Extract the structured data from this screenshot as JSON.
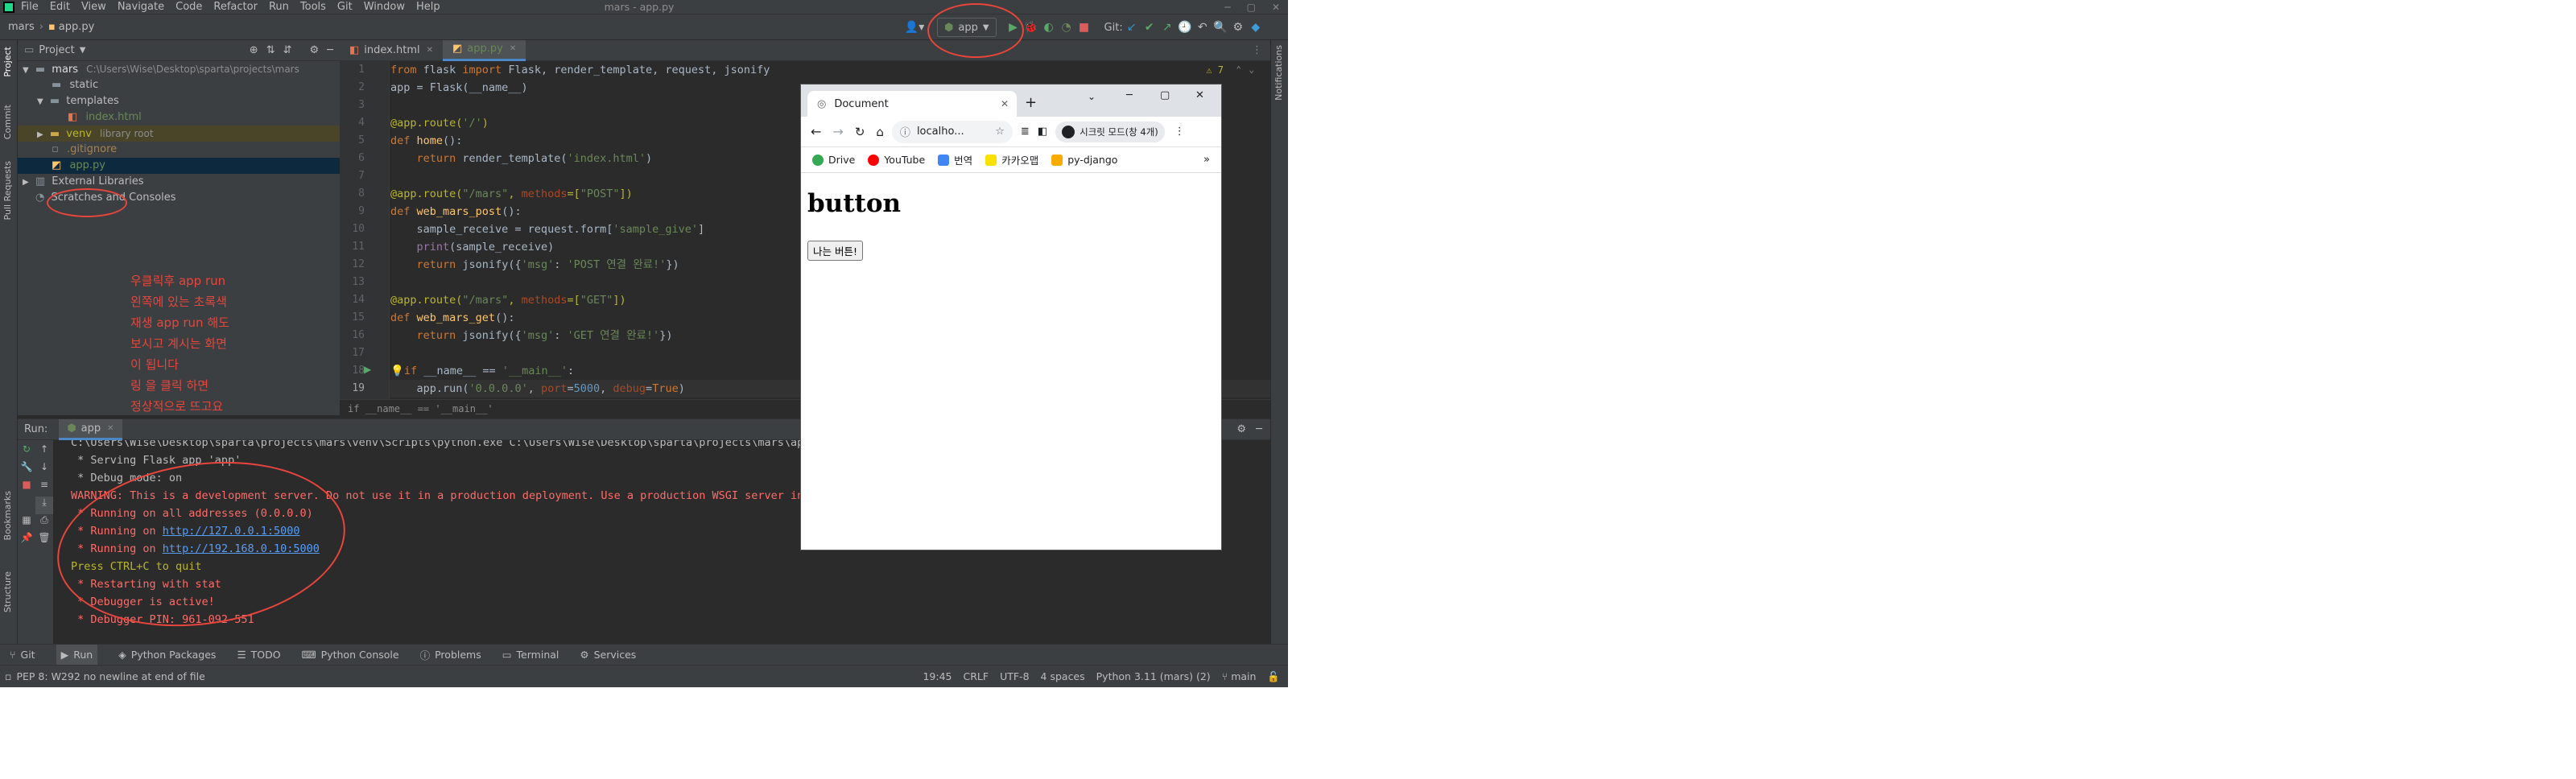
{
  "menu": [
    "File",
    "Edit",
    "View",
    "Navigate",
    "Code",
    "Refactor",
    "Run",
    "Tools",
    "Git",
    "Window",
    "Help"
  ],
  "window_title": "mars - app.py",
  "breadcrumb": {
    "project": "mars",
    "file": "app.py"
  },
  "run_config": "app",
  "git_label": "Git:",
  "project_panel": {
    "title": "Project",
    "tree": [
      {
        "label": "mars",
        "path": "C:\\Users\\Wise\\Desktop\\sparta\\projects\\mars",
        "indent": 0
      },
      {
        "label": "static",
        "indent": 1
      },
      {
        "label": "templates",
        "indent": 1
      },
      {
        "label": "index.html",
        "indent": 2
      },
      {
        "label": "venv",
        "note": "library root",
        "indent": 1
      },
      {
        "label": ".gitignore",
        "indent": 1
      },
      {
        "label": "app.py",
        "indent": 1
      },
      {
        "label": "External Libraries",
        "indent": 0
      },
      {
        "label": "Scratches and Consoles",
        "indent": 0
      }
    ]
  },
  "annotation_lines": [
    "우클릭후 app run",
    "왼쪽에 있는 초록색",
    "재생 app run 해도",
    "보시고 계시는 화면",
    "이 됩니다",
    "링 을 클릭 하면",
    "정상적으로 뜨고요"
  ],
  "editor": {
    "tabs": [
      "index.html",
      "app.py"
    ],
    "inspection": "⚠ 7",
    "line_numbers": [
      "1",
      "2",
      "3",
      "4",
      "5",
      "6",
      "7",
      "8",
      "9",
      "10",
      "11",
      "12",
      "13",
      "14",
      "15",
      "16",
      "17",
      "18",
      "19"
    ],
    "breadcrumb": "if __name__ == '__main__'"
  },
  "run_panel": {
    "label": "Run:",
    "config": "app",
    "lines": [
      "C:\\Users\\Wise\\Desktop\\sparta\\projects\\mars\\venv\\Scripts\\python.exe C:\\Users\\Wise\\Desktop\\sparta\\projects\\mars\\app.py",
      " * Serving Flask app 'app'",
      " * Debug mode: on",
      "WARNING: This is a development server. Do not use it in a production deployment. Use a production WSGI server instead.",
      " * Running on all addresses (0.0.0.0)",
      " * Running on ",
      " * Running on ",
      "Press CTRL+C to quit",
      " * Restarting with stat",
      " * Debugger is active!",
      " * Debugger PIN: 961-092-551"
    ],
    "link1": "http://127.0.0.1:5000",
    "link2": "http://192.168.0.10:5000"
  },
  "bottom_tabs": [
    "Git",
    "Run",
    "Python Packages",
    "TODO",
    "Python Console",
    "Problems",
    "Terminal",
    "Services"
  ],
  "status": {
    "message": "PEP 8: W292 no newline at end of file",
    "position": "19:45",
    "line_sep": "CRLF",
    "encoding": "UTF-8",
    "indent": "4 spaces",
    "interpreter": "Python 3.11 (mars) (2)",
    "branch": "main"
  },
  "side_labels": {
    "left": [
      "Project",
      "Commit",
      "Pull Requests",
      "Bookmarks",
      "Structure"
    ],
    "right": [
      "Notifications"
    ]
  },
  "browser": {
    "tab_title": "Document",
    "address": "localho...",
    "profile": "시크릿 모드(창 4개)",
    "bookmarks": [
      "Drive",
      "YouTube",
      "번역",
      "카카오맵",
      "py-django"
    ],
    "heading": "button",
    "button_label": "나는 버튼!",
    "colors": {
      "drive": "#34a853",
      "youtube": "#ff0000",
      "translate": "#4285f4",
      "kakao": "#fae100",
      "folder": "#f9ab00"
    }
  }
}
